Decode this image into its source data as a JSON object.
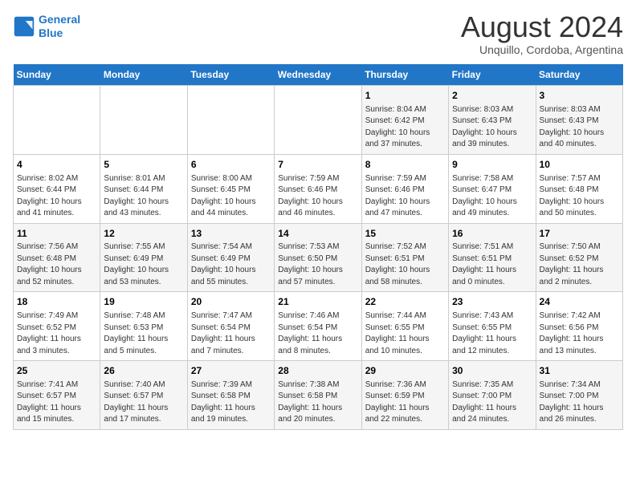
{
  "header": {
    "logo_line1": "General",
    "logo_line2": "Blue",
    "month_year": "August 2024",
    "location": "Unquillo, Cordoba, Argentina"
  },
  "days_of_week": [
    "Sunday",
    "Monday",
    "Tuesday",
    "Wednesday",
    "Thursday",
    "Friday",
    "Saturday"
  ],
  "weeks": [
    [
      {
        "day": "",
        "content": ""
      },
      {
        "day": "",
        "content": ""
      },
      {
        "day": "",
        "content": ""
      },
      {
        "day": "",
        "content": ""
      },
      {
        "day": "1",
        "content": "Sunrise: 8:04 AM\nSunset: 6:42 PM\nDaylight: 10 hours\nand 37 minutes."
      },
      {
        "day": "2",
        "content": "Sunrise: 8:03 AM\nSunset: 6:43 PM\nDaylight: 10 hours\nand 39 minutes."
      },
      {
        "day": "3",
        "content": "Sunrise: 8:03 AM\nSunset: 6:43 PM\nDaylight: 10 hours\nand 40 minutes."
      }
    ],
    [
      {
        "day": "4",
        "content": "Sunrise: 8:02 AM\nSunset: 6:44 PM\nDaylight: 10 hours\nand 41 minutes."
      },
      {
        "day": "5",
        "content": "Sunrise: 8:01 AM\nSunset: 6:44 PM\nDaylight: 10 hours\nand 43 minutes."
      },
      {
        "day": "6",
        "content": "Sunrise: 8:00 AM\nSunset: 6:45 PM\nDaylight: 10 hours\nand 44 minutes."
      },
      {
        "day": "7",
        "content": "Sunrise: 7:59 AM\nSunset: 6:46 PM\nDaylight: 10 hours\nand 46 minutes."
      },
      {
        "day": "8",
        "content": "Sunrise: 7:59 AM\nSunset: 6:46 PM\nDaylight: 10 hours\nand 47 minutes."
      },
      {
        "day": "9",
        "content": "Sunrise: 7:58 AM\nSunset: 6:47 PM\nDaylight: 10 hours\nand 49 minutes."
      },
      {
        "day": "10",
        "content": "Sunrise: 7:57 AM\nSunset: 6:48 PM\nDaylight: 10 hours\nand 50 minutes."
      }
    ],
    [
      {
        "day": "11",
        "content": "Sunrise: 7:56 AM\nSunset: 6:48 PM\nDaylight: 10 hours\nand 52 minutes."
      },
      {
        "day": "12",
        "content": "Sunrise: 7:55 AM\nSunset: 6:49 PM\nDaylight: 10 hours\nand 53 minutes."
      },
      {
        "day": "13",
        "content": "Sunrise: 7:54 AM\nSunset: 6:49 PM\nDaylight: 10 hours\nand 55 minutes."
      },
      {
        "day": "14",
        "content": "Sunrise: 7:53 AM\nSunset: 6:50 PM\nDaylight: 10 hours\nand 57 minutes."
      },
      {
        "day": "15",
        "content": "Sunrise: 7:52 AM\nSunset: 6:51 PM\nDaylight: 10 hours\nand 58 minutes."
      },
      {
        "day": "16",
        "content": "Sunrise: 7:51 AM\nSunset: 6:51 PM\nDaylight: 11 hours\nand 0 minutes."
      },
      {
        "day": "17",
        "content": "Sunrise: 7:50 AM\nSunset: 6:52 PM\nDaylight: 11 hours\nand 2 minutes."
      }
    ],
    [
      {
        "day": "18",
        "content": "Sunrise: 7:49 AM\nSunset: 6:52 PM\nDaylight: 11 hours\nand 3 minutes."
      },
      {
        "day": "19",
        "content": "Sunrise: 7:48 AM\nSunset: 6:53 PM\nDaylight: 11 hours\nand 5 minutes."
      },
      {
        "day": "20",
        "content": "Sunrise: 7:47 AM\nSunset: 6:54 PM\nDaylight: 11 hours\nand 7 minutes."
      },
      {
        "day": "21",
        "content": "Sunrise: 7:46 AM\nSunset: 6:54 PM\nDaylight: 11 hours\nand 8 minutes."
      },
      {
        "day": "22",
        "content": "Sunrise: 7:44 AM\nSunset: 6:55 PM\nDaylight: 11 hours\nand 10 minutes."
      },
      {
        "day": "23",
        "content": "Sunrise: 7:43 AM\nSunset: 6:55 PM\nDaylight: 11 hours\nand 12 minutes."
      },
      {
        "day": "24",
        "content": "Sunrise: 7:42 AM\nSunset: 6:56 PM\nDaylight: 11 hours\nand 13 minutes."
      }
    ],
    [
      {
        "day": "25",
        "content": "Sunrise: 7:41 AM\nSunset: 6:57 PM\nDaylight: 11 hours\nand 15 minutes."
      },
      {
        "day": "26",
        "content": "Sunrise: 7:40 AM\nSunset: 6:57 PM\nDaylight: 11 hours\nand 17 minutes."
      },
      {
        "day": "27",
        "content": "Sunrise: 7:39 AM\nSunset: 6:58 PM\nDaylight: 11 hours\nand 19 minutes."
      },
      {
        "day": "28",
        "content": "Sunrise: 7:38 AM\nSunset: 6:58 PM\nDaylight: 11 hours\nand 20 minutes."
      },
      {
        "day": "29",
        "content": "Sunrise: 7:36 AM\nSunset: 6:59 PM\nDaylight: 11 hours\nand 22 minutes."
      },
      {
        "day": "30",
        "content": "Sunrise: 7:35 AM\nSunset: 7:00 PM\nDaylight: 11 hours\nand 24 minutes."
      },
      {
        "day": "31",
        "content": "Sunrise: 7:34 AM\nSunset: 7:00 PM\nDaylight: 11 hours\nand 26 minutes."
      }
    ]
  ]
}
